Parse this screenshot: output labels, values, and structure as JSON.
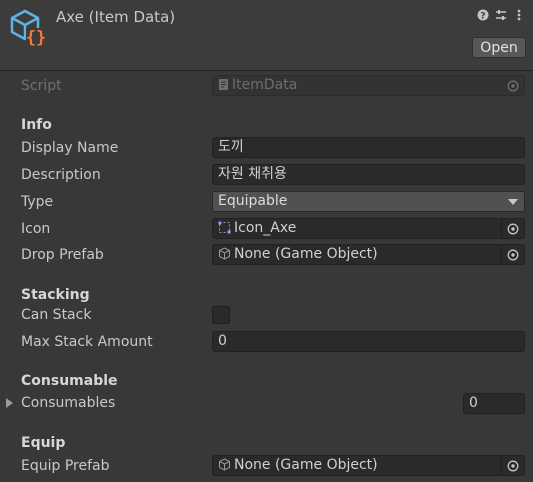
{
  "header": {
    "title": "Axe (Item Data)",
    "icons": [
      "help-icon",
      "presets-icon",
      "more-menu-icon"
    ],
    "open_label": "Open"
  },
  "script": {
    "label": "Script",
    "value": "ItemData"
  },
  "info": {
    "section": "Info",
    "display_name": {
      "label": "Display Name",
      "value": "도끼"
    },
    "description": {
      "label": "Description",
      "value": "자원 채취용"
    },
    "type": {
      "label": "Type",
      "value": "Equipable"
    },
    "icon": {
      "label": "Icon",
      "value": "Icon_Axe"
    },
    "drop_prefab": {
      "label": "Drop Prefab",
      "value": "None (Game Object)"
    }
  },
  "stacking": {
    "section": "Stacking",
    "can_stack": {
      "label": "Can Stack",
      "checked": false
    },
    "max_stack": {
      "label": "Max Stack Amount",
      "value": "0"
    }
  },
  "consumable": {
    "section": "Consumable",
    "consumables": {
      "label": "Consumables",
      "value": "0"
    }
  },
  "equip": {
    "section": "Equip",
    "equip_prefab": {
      "label": "Equip Prefab",
      "value": "None (Game Object)"
    }
  },
  "colors": {
    "background": "#383838",
    "field": "#2a2a2a",
    "accent_icon_blue": "#5fb4e6",
    "accent_icon_orange": "#f07838"
  }
}
